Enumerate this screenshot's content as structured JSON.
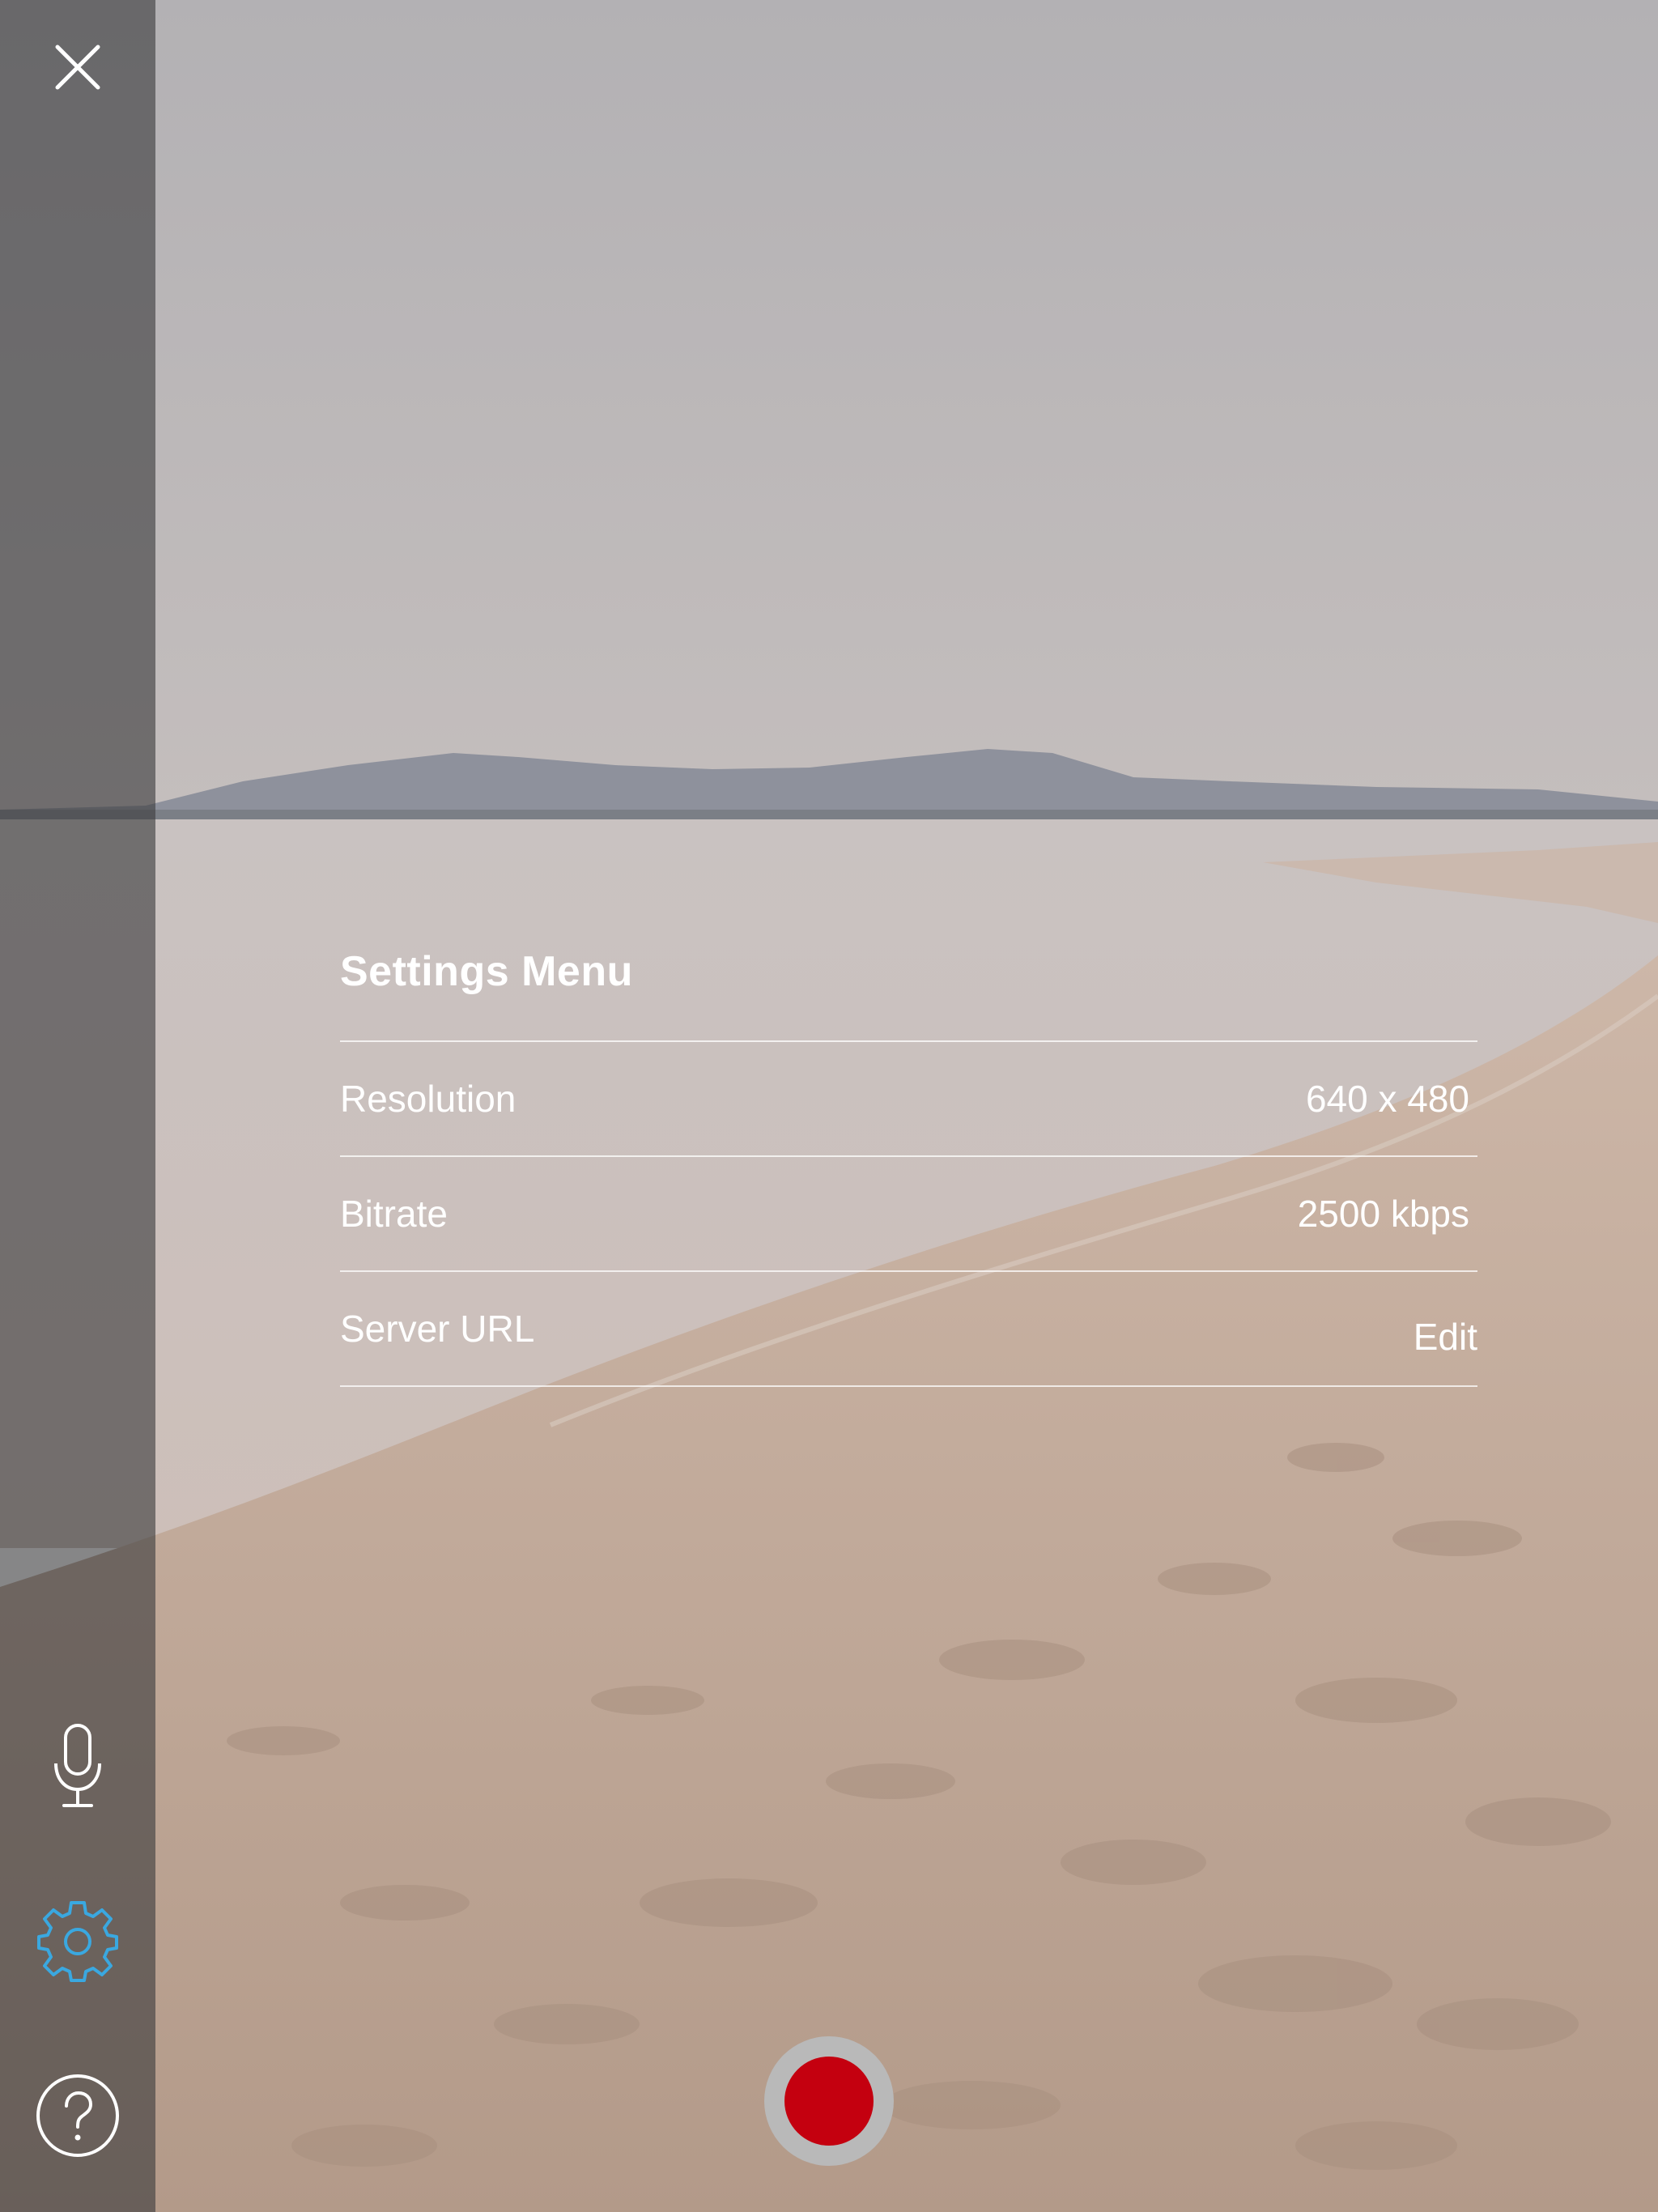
{
  "sidebar": {
    "close_icon": "close-icon",
    "mic_icon": "microphone-icon",
    "settings_icon": "gear-icon",
    "help_icon": "help-icon",
    "active_color": "#3aa8e0"
  },
  "settings": {
    "title": "Settings Menu",
    "rows": [
      {
        "label": "Resolution",
        "value": "640 x 480"
      },
      {
        "label": "Bitrate",
        "value": "2500 kbps"
      },
      {
        "label": "Server URL",
        "value": "Edit"
      }
    ]
  },
  "record": {
    "color": "#c4000f"
  }
}
